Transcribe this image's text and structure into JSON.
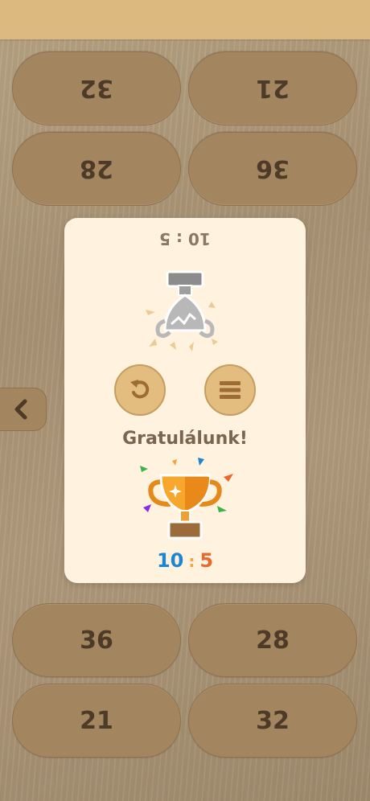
{
  "top_player": {
    "options": [
      "32",
      "21",
      "28",
      "36"
    ]
  },
  "bottom_player": {
    "options": [
      "36",
      "28",
      "21",
      "32"
    ]
  },
  "modal": {
    "top_score": "10 : 5",
    "message": "Gratulálunk!",
    "score_left": "10",
    "score_sep": ":",
    "score_right": "5"
  },
  "icons": {
    "back": "chevron-left-icon",
    "replay": "replay-icon",
    "menu": "menu-icon",
    "broken_trophy": "broken-trophy-icon",
    "trophy": "trophy-icon"
  },
  "colors": {
    "score_left": "#1d86d0",
    "score_right": "#e8692b",
    "button_fill": "#e3bd80",
    "pill_fill": "#a3855f"
  }
}
